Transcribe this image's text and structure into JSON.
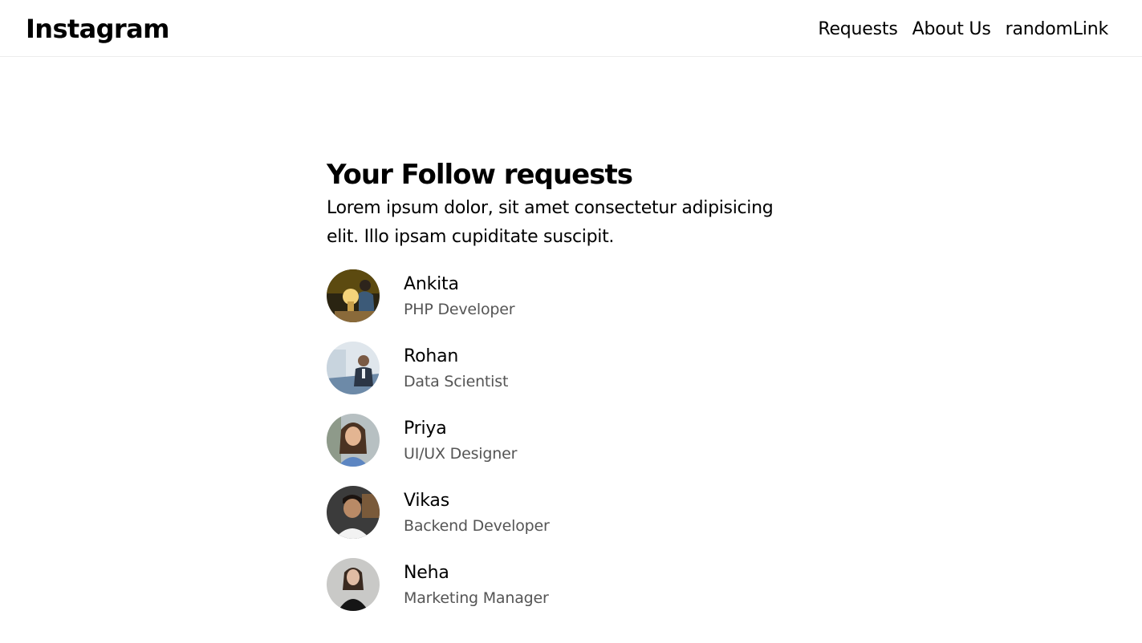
{
  "navbar": {
    "brand": "Instagram",
    "links": [
      "Requests",
      "About Us",
      "randomLink"
    ]
  },
  "main": {
    "title": "Your Follow requests",
    "description": "Lorem ipsum dolor, sit amet consectetur adipisicing elit. Illo ipsam cupiditate suscipit."
  },
  "requests": [
    {
      "name": "Ankita",
      "role": "PHP Developer"
    },
    {
      "name": "Rohan",
      "role": "Data Scientist"
    },
    {
      "name": "Priya",
      "role": "UI/UX Designer"
    },
    {
      "name": "Vikas",
      "role": "Backend Developer"
    },
    {
      "name": "Neha",
      "role": "Marketing Manager"
    }
  ],
  "colors": {
    "text": "#000000",
    "secondary_text": "#555555",
    "divider": "#ececec"
  }
}
